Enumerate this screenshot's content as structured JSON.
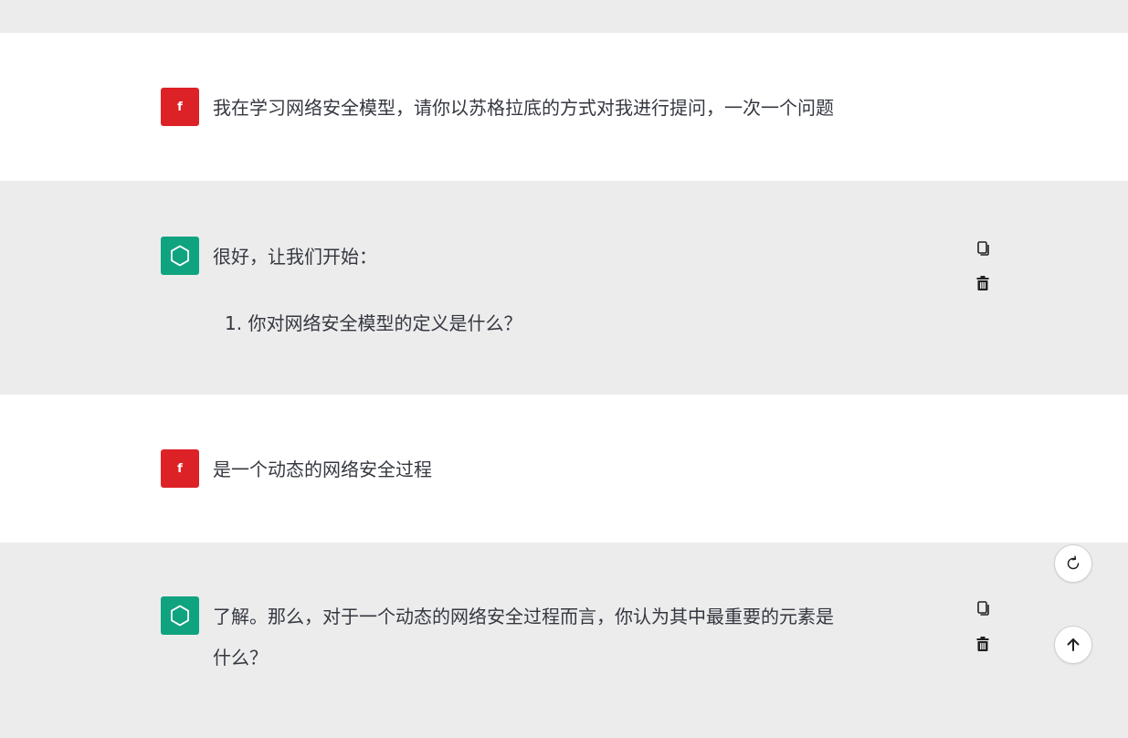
{
  "conversation": {
    "messages": [
      {
        "role": "user",
        "avatar_label": "f",
        "text": "我在学习网络安全模型，请你以苏格拉底的方式对我进行提问，一次一个问题"
      },
      {
        "role": "assistant",
        "text": "很好，让我们开始：",
        "list": [
          "1. 你对网络安全模型的定义是什么？"
        ]
      },
      {
        "role": "user",
        "avatar_label": "f",
        "text": "是一个动态的网络安全过程"
      },
      {
        "role": "assistant",
        "text_line1": "了解。那么，对于一个动态的网络安全过程而言，你认为其中最重要的元素是",
        "text_line2": "什么？"
      }
    ]
  },
  "icons": {
    "copy": "copy-icon",
    "delete": "trash-icon",
    "regenerate": "refresh-icon",
    "scroll_top": "arrow-up-icon",
    "bot_avatar": "openai-logo-icon"
  },
  "colors": {
    "user_avatar": "#dd2227",
    "bot_avatar": "#10a37f",
    "gray_band": "#ececec"
  }
}
